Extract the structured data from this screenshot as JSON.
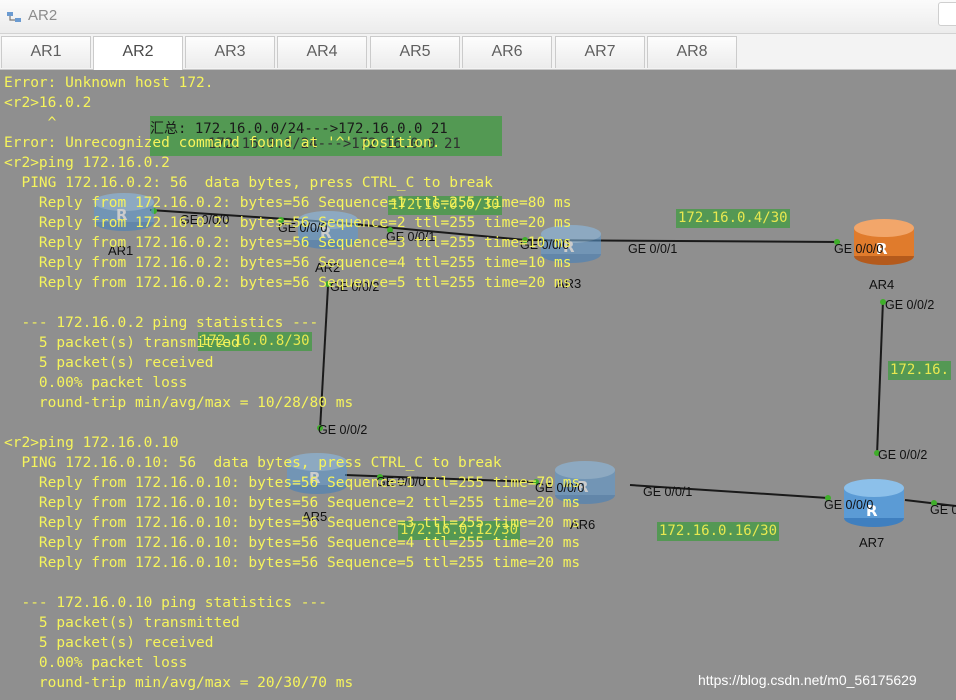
{
  "window": {
    "title": "AR2"
  },
  "tabs": [
    "AR1",
    "AR2",
    "AR3",
    "AR4",
    "AR5",
    "AR6",
    "AR7",
    "AR8"
  ],
  "active_tab": "AR2",
  "console_lines": [
    "Error: Unknown host 172.",
    "<r2>16.0.2",
    "     ^",
    "Error: Unrecognized command found at '^' position.",
    "<r2>ping 172.16.0.2",
    "  PING 172.16.0.2: 56  data bytes, press CTRL_C to break",
    "    Reply from 172.16.0.2: bytes=56 Sequence=1 ttl=255 time=80 ms",
    "    Reply from 172.16.0.2: bytes=56 Sequence=2 ttl=255 time=20 ms",
    "    Reply from 172.16.0.2: bytes=56 Sequence=3 ttl=255 time=10 ms",
    "    Reply from 172.16.0.2: bytes=56 Sequence=4 ttl=255 time=10 ms",
    "    Reply from 172.16.0.2: bytes=56 Sequence=5 ttl=255 time=20 ms",
    "",
    "  --- 172.16.0.2 ping statistics ---",
    "    5 packet(s) transmitted",
    "    5 packet(s) received",
    "    0.00% packet loss",
    "    round-trip min/avg/max = 10/28/80 ms",
    "",
    "<r2>ping 172.16.0.10",
    "  PING 172.16.0.10: 56  data bytes, press CTRL_C to break",
    "    Reply from 172.16.0.10: bytes=56 Sequence=1 ttl=255 time=70 ms",
    "    Reply from 172.16.0.10: bytes=56 Sequence=2 ttl=255 time=20 ms",
    "    Reply from 172.16.0.10: bytes=56 Sequence=3 ttl=255 time=20 ms",
    "    Reply from 172.16.0.10: bytes=56 Sequence=4 ttl=255 time=20 ms",
    "    Reply from 172.16.0.10: bytes=56 Sequence=5 ttl=255 time=20 ms",
    "",
    "  --- 172.16.0.10 ping statistics ---",
    "    5 packet(s) transmitted",
    "    5 packet(s) received",
    "    0.00% packet loss",
    "    round-trip min/avg/max = 20/30/70 ms"
  ],
  "topology": {
    "summary_line1": "汇总: 172.16.0.0/24--->172.16.0.0 21",
    "summary_line2": "172.16.0.0/24--->172.16.0.0 21",
    "subnet_ar1_ar3": "172.16.0.0/30",
    "subnet_ar3_ar4": "172.16.0.4/30",
    "subnet_ar2_ar5": "172.16.0.8/30",
    "subnet_ar5_ar6": "172.16.0.12/30",
    "subnet_ar6_ar7": "172.16.0.16/30",
    "subnet_ar4_ar7": "172.16.",
    "routers": {
      "ar1": "AR1",
      "ar2": "AR2",
      "ar3": "AR3",
      "ar4": "AR4",
      "ar5": "AR5",
      "ar6": "AR6",
      "ar7": "AR7"
    },
    "ports": {
      "ar1_ge000": "GE 0/0/0",
      "ar2_ge000": "GE 0/0/0",
      "ar2_ge001": "GE 0/0/1",
      "ar2_ge002": "GE 0/0/2",
      "ar3_ge000": "GE 0/0/0",
      "ar3_ge001": "GE 0/0/1",
      "ar4_ge000": "GE 0/0/0",
      "ar4_ge002": "GE 0/0/2",
      "ar5_ge002": "GE 0/0/2",
      "ar5_ge000": "GE 0/0/0",
      "ar6_ge000": "GE 0/0/0",
      "ar6_ge001": "GE 0/0/1",
      "ar7_ge002": "GE 0/0/2",
      "ar7_ge000": "GE 0/0/0",
      "ar7_right": "GE 0"
    }
  },
  "watermark": "https://blog.csdn.net/m0_56175629",
  "colors": {
    "console_bg": "#8f8f8f",
    "console_text": "#f6f45c",
    "label_bg": "#4e9a4e",
    "router_blue": "#5b9bd5",
    "router_orange": "#e07b2c",
    "link": "#1a1a1a",
    "port_dot": "#3fae2a"
  }
}
